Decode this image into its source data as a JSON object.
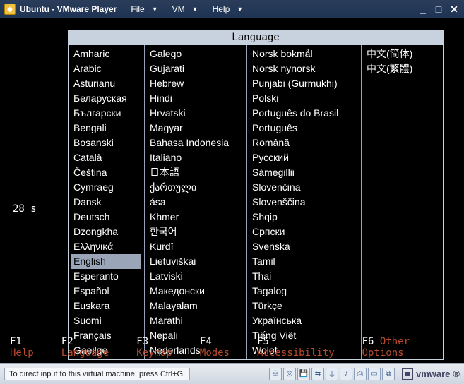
{
  "window": {
    "title": "Ubuntu - VMware Player",
    "menu": [
      "File",
      "VM",
      "Help"
    ]
  },
  "timer": "28 s",
  "language_dialog": {
    "header": "Language",
    "selected": "English",
    "columns": [
      [
        "Amharic",
        "Arabic",
        "Asturianu",
        "Беларуская",
        "Български",
        "Bengali",
        "Bosanski",
        "Català",
        "Čeština",
        "Cymraeg",
        "Dansk",
        "Deutsch",
        "Dzongkha",
        "Ελληνικά",
        "English",
        "Esperanto",
        "Español",
        "Euskara",
        "Suomi",
        "Français",
        "Gaeilge"
      ],
      [
        "Galego",
        "Gujarati",
        "Hebrew",
        "Hindi",
        "Hrvatski",
        "Magyar",
        "Bahasa Indonesia",
        "Italiano",
        "日本語",
        "ქართული",
        "ása",
        "Khmer",
        "한국어",
        "Kurdî",
        "Lietuviškai",
        "Latviski",
        "Македонски",
        "Malayalam",
        "Marathi",
        "Nepali",
        "Nederlands"
      ],
      [
        "Norsk bokmål",
        "Norsk nynorsk",
        "Punjabi (Gurmukhi)",
        "Polski",
        "Português do Brasil",
        "Português",
        "Română",
        "Русский",
        "Sámegillii",
        "Slovenčina",
        "Slovenščina",
        "Shqip",
        "Српски",
        "Svenska",
        "Tamil",
        "Thai",
        "Tagalog",
        "Türkçe",
        "Українська",
        "Tiếng Việt",
        "Wolof"
      ],
      [
        "中文(简体)",
        "中文(繁體)"
      ]
    ]
  },
  "function_keys": [
    {
      "key": "F1",
      "label": "Help"
    },
    {
      "key": "F2",
      "label": "Language"
    },
    {
      "key": "F3",
      "label": "Keymap"
    },
    {
      "key": "F4",
      "label": "Modes"
    },
    {
      "key": "F5",
      "label": "Accessibility"
    },
    {
      "key": "F6",
      "label": "Other Options"
    }
  ],
  "statusbar": {
    "hint": "To direct input to this virtual machine, press Ctrl+G.",
    "device_icons": [
      "hard-disk",
      "cd-dvd",
      "floppy",
      "network",
      "usb",
      "sound",
      "printer",
      "display",
      "shared-folders"
    ],
    "logo": "vmware"
  }
}
